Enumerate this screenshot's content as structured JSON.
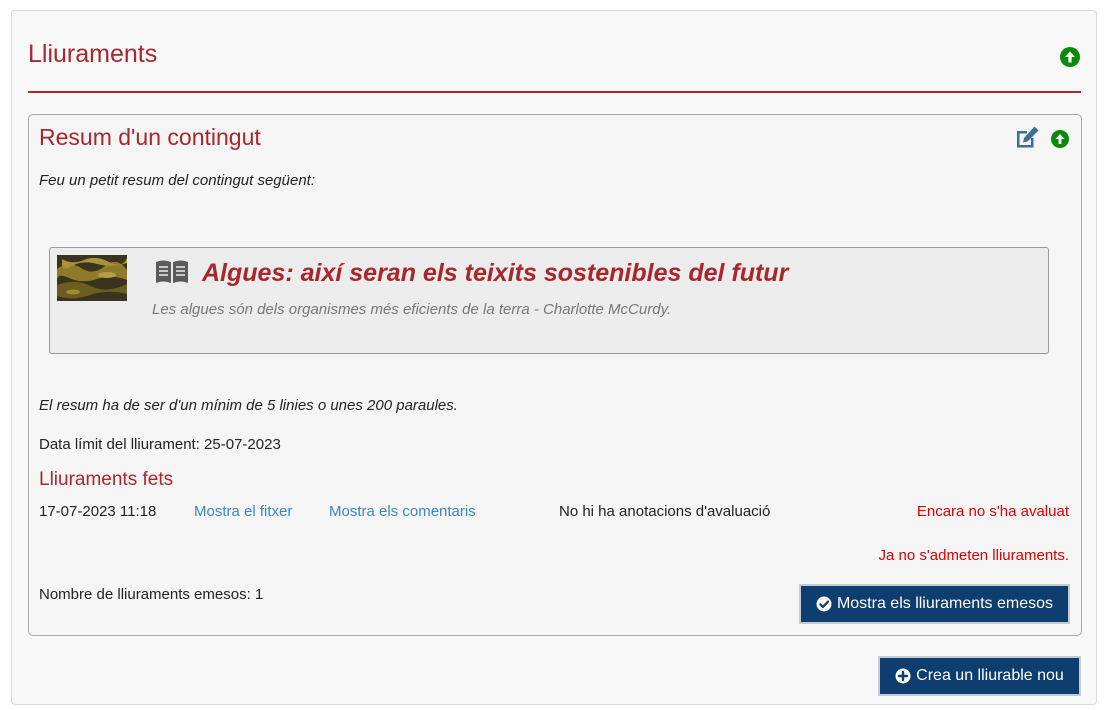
{
  "page": {
    "title": "Lliuraments"
  },
  "card": {
    "title": "Resum d'un contingut",
    "instructions": "Feu un petit resum del contingut següent:",
    "content": {
      "title": "Algues: així seran els teixits sostenibles del futur",
      "subtitle": "Les algues són dels organismes més eficients de la terra - Charlotte McCurdy."
    },
    "requirements": "El resum ha de ser d'un mínim de 5 linies o unes 200 paraules.",
    "deadline": "Data límit del lliurament: 25-07-2023",
    "submissions_heading": "Lliuraments fets",
    "submission": {
      "datetime": "17-07-2023 11:18",
      "show_file": "Mostra el fitxer",
      "show_comments": "Mostra els comentaris",
      "annotations": "No hi ha anotacions d'avaluació",
      "status": "Encara no s'ha avaluat"
    },
    "closed_notice": "Ja no s'admeten lliuraments.",
    "count_text": "Nombre de lliuraments emesos: 1",
    "show_button": "Mostra els lliuraments emesos"
  },
  "create_button": "Crea un lliurable nou",
  "icons": {
    "up": "arrow-circle-up-icon",
    "edit": "edit-icon",
    "book": "book-open-icon",
    "check": "check-circle-icon",
    "plus": "plus-circle-icon"
  },
  "colors": {
    "title_red": "#a8272d",
    "link_blue": "#3a87c0",
    "status_red": "#dd0000",
    "button_navy": "#0e3d70",
    "up_green": "#0a8a0a"
  }
}
